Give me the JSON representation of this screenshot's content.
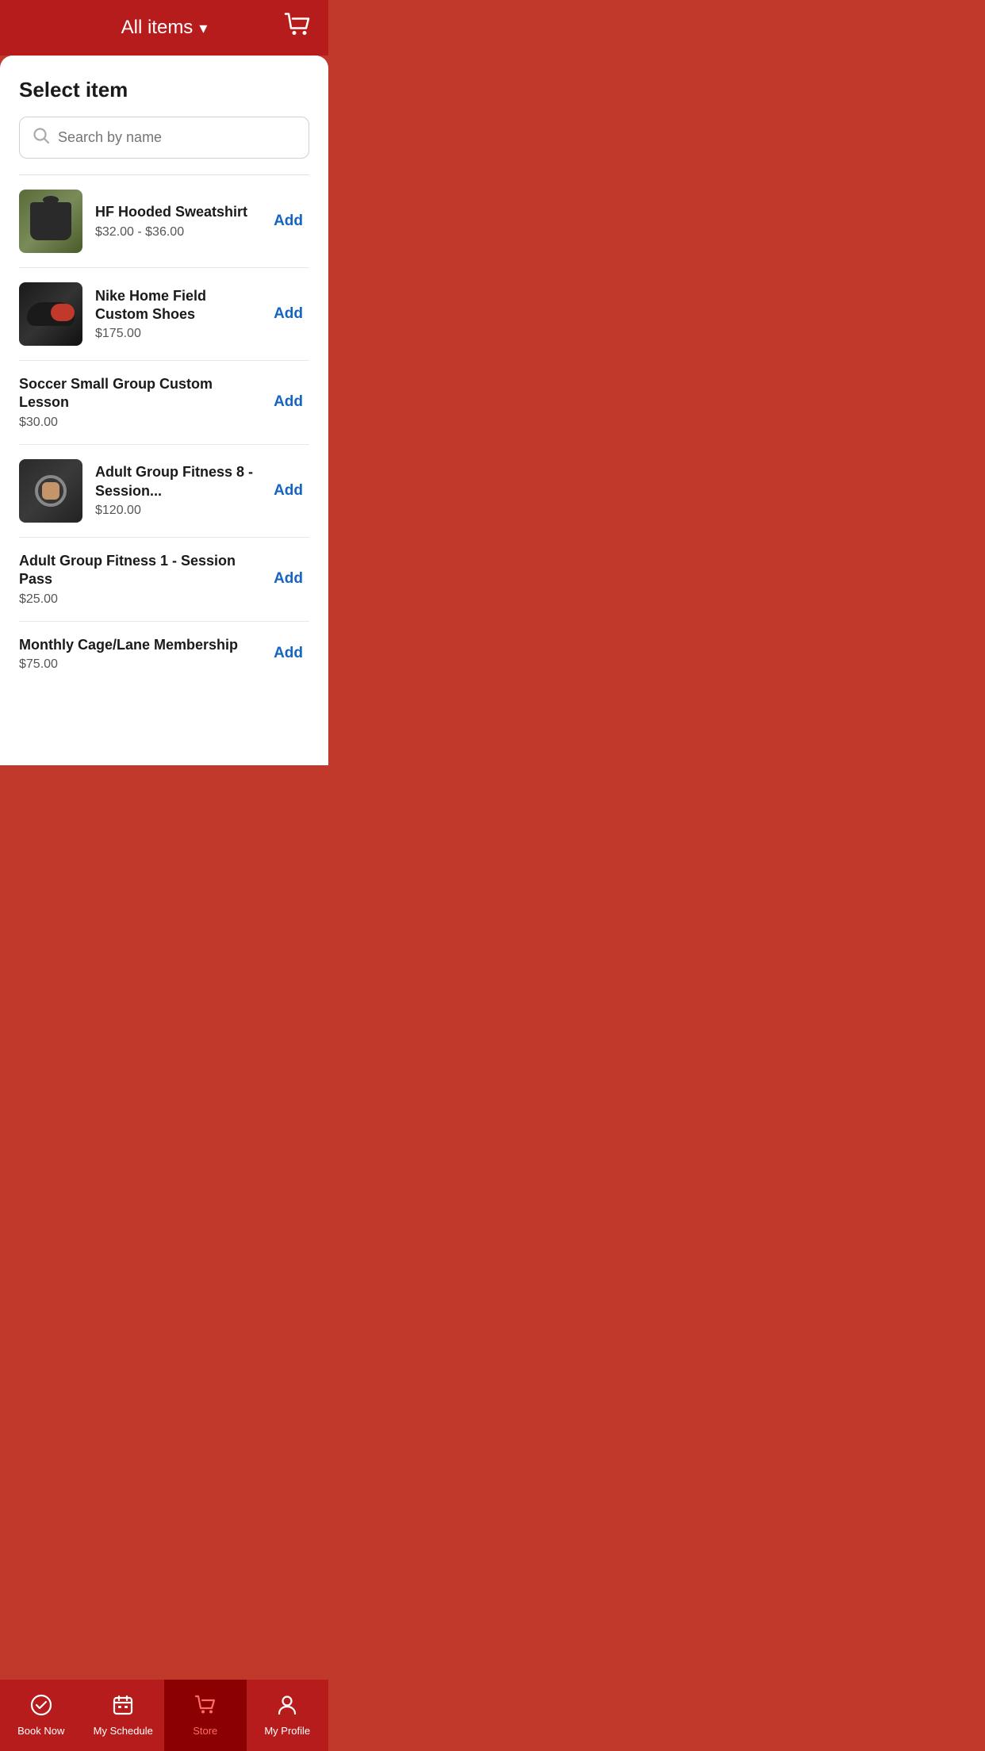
{
  "header": {
    "title": "All items",
    "chevron": "▾",
    "cart_icon_label": "cart"
  },
  "main": {
    "section_title": "Select item",
    "search": {
      "placeholder": "Search by name"
    },
    "items": [
      {
        "id": "hf-hooded-sweatshirt",
        "name": "HF Hooded Sweatshirt",
        "price": "$32.00 - $36.00",
        "has_image": true,
        "image_type": "sweatshirt",
        "add_label": "Add"
      },
      {
        "id": "nike-home-field-shoes",
        "name": "Nike Home Field Custom Shoes",
        "price": "$175.00",
        "has_image": true,
        "image_type": "shoes",
        "add_label": "Add"
      },
      {
        "id": "soccer-small-group",
        "name": "Soccer Small Group Custom Lesson",
        "price": "$30.00",
        "has_image": false,
        "image_type": "none",
        "add_label": "Add"
      },
      {
        "id": "adult-group-fitness-8",
        "name": "Adult Group Fitness 8 - Session...",
        "price": "$120.00",
        "has_image": true,
        "image_type": "fitness",
        "add_label": "Add"
      },
      {
        "id": "adult-group-fitness-1",
        "name": "Adult Group Fitness 1 - Session Pass",
        "price": "$25.00",
        "has_image": false,
        "image_type": "none",
        "add_label": "Add"
      },
      {
        "id": "monthly-cage-lane",
        "name": "Monthly Cage/Lane Membership",
        "price": "$75.00",
        "has_image": false,
        "image_type": "none",
        "add_label": "Add"
      }
    ]
  },
  "bottom_nav": {
    "items": [
      {
        "id": "book-now",
        "label": "Book Now",
        "icon": "check-circle",
        "active": false
      },
      {
        "id": "my-schedule",
        "label": "My Schedule",
        "icon": "calendar",
        "active": false
      },
      {
        "id": "store",
        "label": "Store",
        "icon": "cart",
        "active": true
      },
      {
        "id": "my-profile",
        "label": "My Profile",
        "icon": "person",
        "active": false
      }
    ]
  },
  "colors": {
    "header_bg": "#b71c1c",
    "accent_blue": "#1565c0",
    "active_nav_bg": "#8b0000",
    "active_nav_color": "#ff6b6b"
  }
}
